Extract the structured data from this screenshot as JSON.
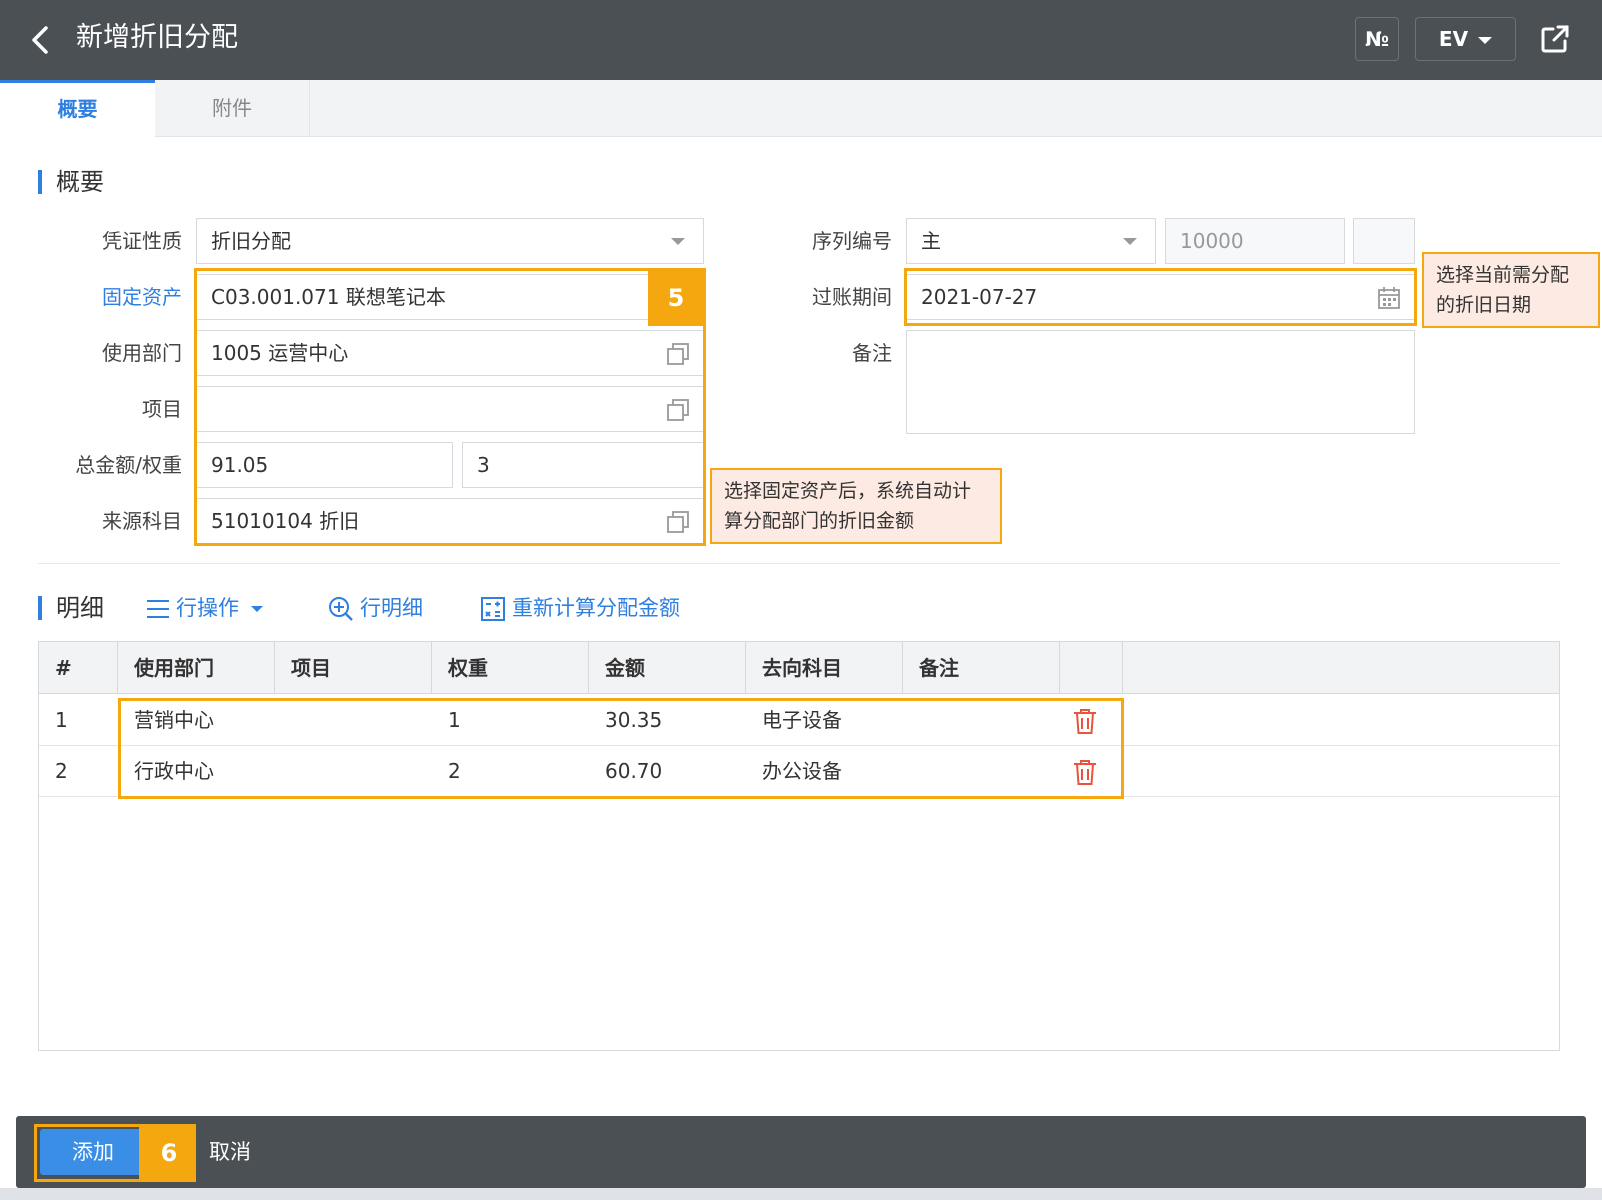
{
  "header": {
    "title": "新增折旧分配",
    "numbering_button": "№",
    "ev_button": "EV"
  },
  "tabs": [
    {
      "label": "概要",
      "active": true
    },
    {
      "label": "附件",
      "active": false
    }
  ],
  "summary": {
    "section_title": "概要",
    "fields": {
      "voucher_type": {
        "label": "凭证性质",
        "value": "折旧分配"
      },
      "fixed_asset": {
        "label": "固定资产",
        "value": "C03.001.071 联想笔记本"
      },
      "department": {
        "label": "使用部门",
        "value": "1005 运营中心"
      },
      "project": {
        "label": "项目",
        "value": ""
      },
      "total_weight": {
        "label": "总金额/权重",
        "amount": "91.05",
        "weight": "3"
      },
      "source_account": {
        "label": "来源科目",
        "value": "51010104 折旧"
      },
      "serial_no": {
        "label": "序列编号",
        "value": "主",
        "number": "10000",
        "extra": ""
      },
      "posting_period": {
        "label": "过账期间",
        "value": "2021-07-27"
      },
      "remarks": {
        "label": "备注",
        "value": ""
      }
    }
  },
  "annotations": {
    "step5": "5",
    "step6": "6",
    "callout_asset": "选择固定资产后，系统自动计算分配部门的折旧金额",
    "callout_date": "选择当前需分配的折旧日期"
  },
  "detail": {
    "section_title": "明细",
    "toolbar": {
      "row_ops": "行操作",
      "row_detail": "行明细",
      "recalc": "重新计算分配金额"
    },
    "columns": [
      "#",
      "使用部门",
      "项目",
      "权重",
      "金额",
      "去向科目",
      "备注"
    ],
    "rows": [
      {
        "no": "1",
        "department": "营销中心",
        "project": "",
        "weight": "1",
        "amount": "30.35",
        "target_account": "电子设备",
        "remarks": ""
      },
      {
        "no": "2",
        "department": "行政中心",
        "project": "",
        "weight": "2",
        "amount": "60.70",
        "target_account": "办公设备",
        "remarks": ""
      }
    ]
  },
  "footer": {
    "add_label": "添加",
    "cancel_label": "取消"
  },
  "colors": {
    "header_bg": "#4b5055",
    "accent": "#2f7fe0",
    "highlight": "#f5a70f",
    "callout_bg": "#fdebe3",
    "danger": "#e8553e"
  }
}
